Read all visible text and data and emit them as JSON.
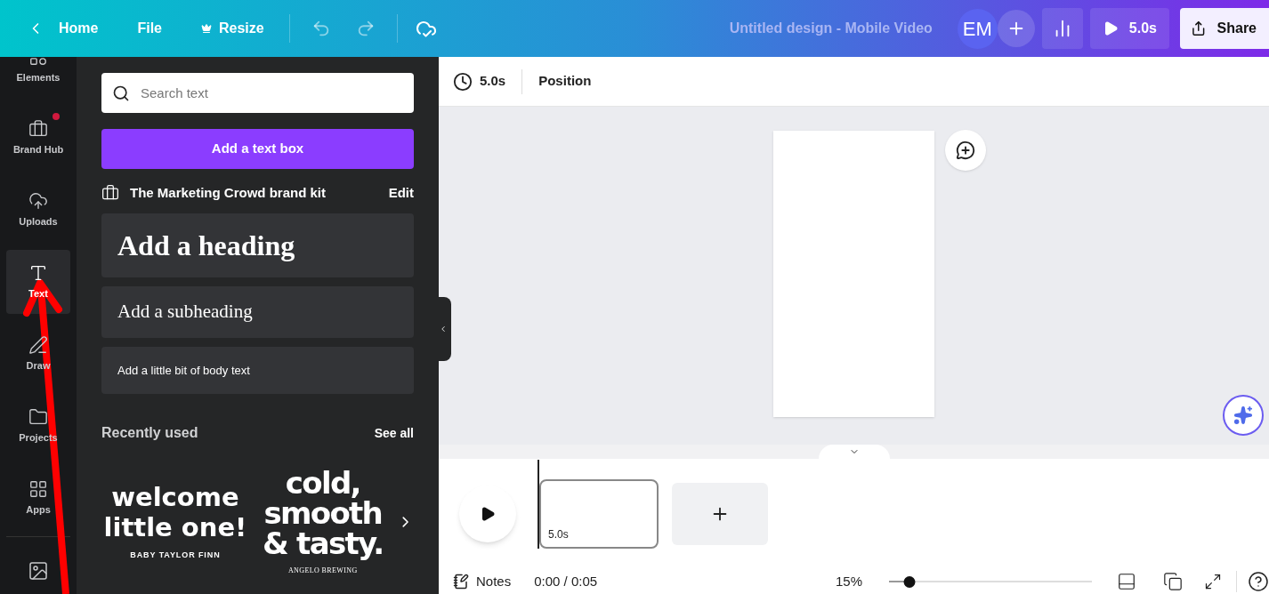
{
  "topbar": {
    "nav": [
      {
        "kind": "back",
        "label": "Home"
      },
      {
        "kind": "plain",
        "label": "File"
      },
      {
        "kind": "premium",
        "label": "Resize"
      }
    ],
    "title": "Untitled design - Mobile Video",
    "avatar": "EM",
    "play_label": "5.0s",
    "share": "Share"
  },
  "sidebar": {
    "items": [
      {
        "kind": "elements",
        "label": "Elements",
        "selected": false
      },
      {
        "kind": "brand",
        "label": "Brand Hub",
        "selected": false,
        "badge": true
      },
      {
        "kind": "uploads",
        "label": "Uploads",
        "selected": false
      },
      {
        "kind": "text",
        "label": "Text",
        "selected": true
      },
      {
        "kind": "draw",
        "label": "Draw",
        "selected": false
      },
      {
        "kind": "projects",
        "label": "Projects",
        "selected": false
      },
      {
        "kind": "apps",
        "label": "Apps",
        "selected": false
      }
    ]
  },
  "panel": {
    "search": {
      "placeholder": "Search text"
    },
    "add_button": "Add a text box",
    "brand_kit": {
      "name": "The Marketing Crowd brand kit",
      "action": "Edit"
    },
    "styles": [
      {
        "kind": "heading",
        "label": "Add a heading"
      },
      {
        "kind": "subheading",
        "label": "Add a subheading"
      },
      {
        "kind": "body",
        "label": "Add a little bit of body text"
      }
    ],
    "recent": {
      "title": "Recently used",
      "action": "See all",
      "templates": [
        {
          "kind": "rounded",
          "lines": [
            "welcome",
            "little one!"
          ],
          "caption": "BABY TAYLOR FINN"
        },
        {
          "kind": "bold",
          "lines": [
            "cold,",
            "smooth",
            "& tasty."
          ],
          "caption": "ANGELO BREWING"
        }
      ]
    }
  },
  "toolbar": {
    "duration": "5.0s",
    "position": "Position"
  },
  "timeline": {
    "clips": [
      {
        "duration": "5.0s",
        "selected": true
      }
    ]
  },
  "bottom": {
    "notes": "Notes",
    "time": "0:00 / 0:05",
    "zoom": "15%",
    "level": 0.1
  }
}
